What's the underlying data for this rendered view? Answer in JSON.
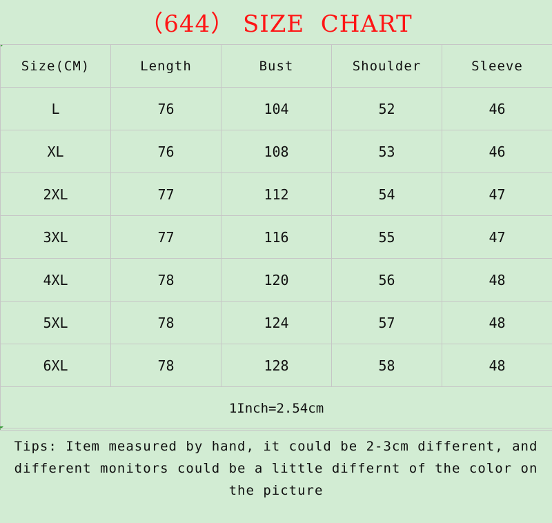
{
  "title": "（644） SIZE  CHART",
  "colors": {
    "background": "#d2ecd3",
    "title": "#ff1515",
    "text": "#111111",
    "grid": "#c6c6c6"
  },
  "table": {
    "headers": [
      "Size(CM)",
      "Length",
      "Bust",
      "Shoulder",
      "Sleeve"
    ],
    "rows": [
      [
        "L",
        "76",
        "104",
        "52",
        "46"
      ],
      [
        "XL",
        "76",
        "108",
        "53",
        "46"
      ],
      [
        "2XL",
        "77",
        "112",
        "54",
        "47"
      ],
      [
        "3XL",
        "77",
        "116",
        "55",
        "47"
      ],
      [
        "4XL",
        "78",
        "120",
        "56",
        "48"
      ],
      [
        "5XL",
        "78",
        "124",
        "57",
        "48"
      ],
      [
        "6XL",
        "78",
        "128",
        "58",
        "48"
      ]
    ],
    "conversion": "1Inch=2.54cm"
  },
  "tips": "Tips: Item measured by hand, it could be 2-3cm different, and different monitors could be a little differnt of the color on the picture"
}
